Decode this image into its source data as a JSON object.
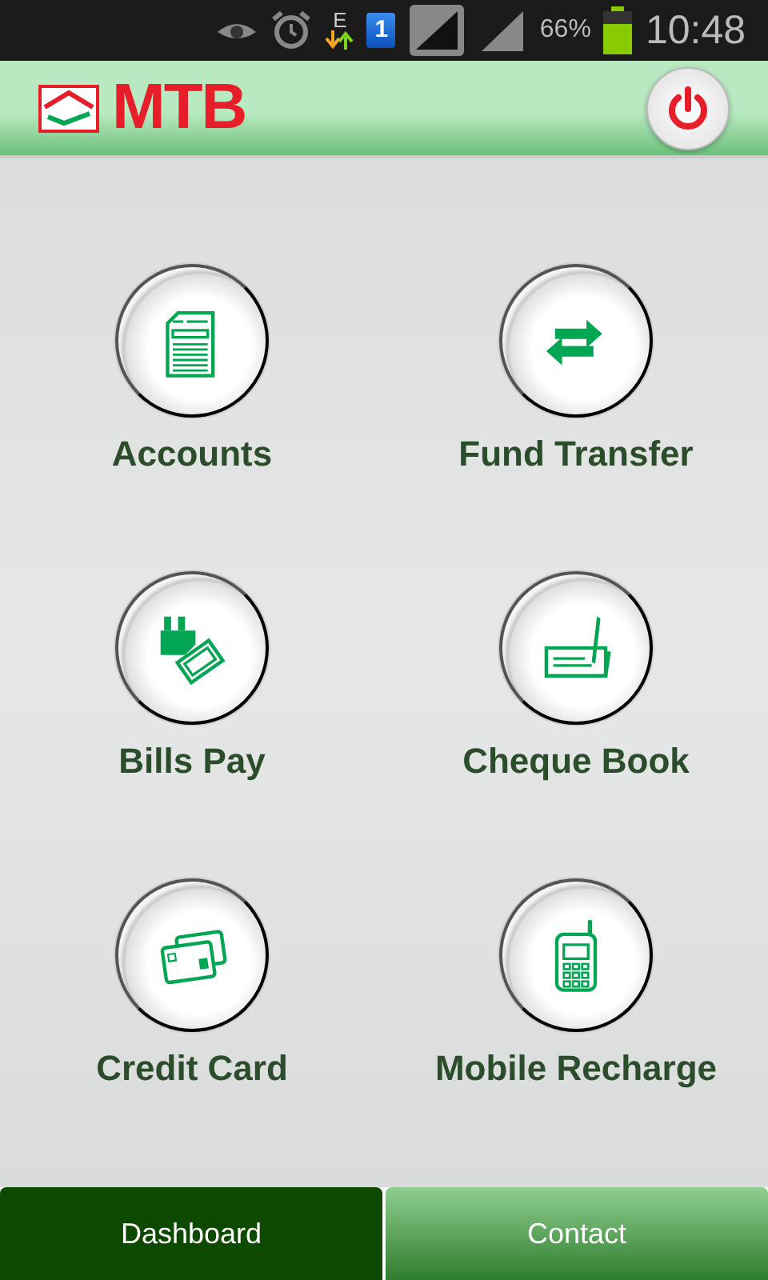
{
  "status_bar": {
    "network_type": "E",
    "sim": "1",
    "battery": "66%",
    "time": "10:48"
  },
  "header": {
    "logo": "MTB"
  },
  "tiles": [
    {
      "kind": "accounts",
      "label": "Accounts"
    },
    {
      "kind": "transfer",
      "label": "Fund Transfer"
    },
    {
      "kind": "bills",
      "label": "Bills Pay"
    },
    {
      "kind": "cheque",
      "label": "Cheque Book"
    },
    {
      "kind": "card",
      "label": "Credit Card"
    },
    {
      "kind": "mobile",
      "label": "Mobile Recharge"
    }
  ],
  "tabs": [
    {
      "label": "Dashboard",
      "selected": true
    },
    {
      "label": "Contact",
      "selected": false
    }
  ]
}
